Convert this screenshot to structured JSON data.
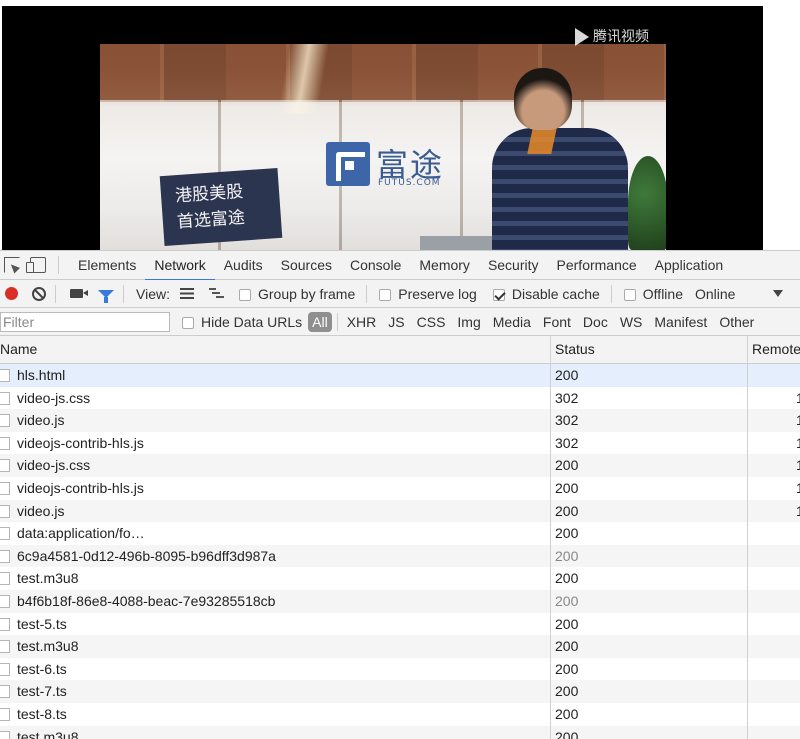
{
  "video": {
    "logo_text": "富途",
    "logo_sub": "FUTUS.COM",
    "poster_lines": [
      "港股美股",
      "首选富途"
    ],
    "watermark": "腾讯视频"
  },
  "devtools": {
    "tabs": [
      {
        "label": "Elements",
        "active": false
      },
      {
        "label": "Network",
        "active": true
      },
      {
        "label": "Audits",
        "active": false
      },
      {
        "label": "Sources",
        "active": false
      },
      {
        "label": "Console",
        "active": false
      },
      {
        "label": "Memory",
        "active": false
      },
      {
        "label": "Security",
        "active": false
      },
      {
        "label": "Performance",
        "active": false
      },
      {
        "label": "Application",
        "active": false
      }
    ],
    "toolbar": {
      "view_label": "View:",
      "group_by_frame": {
        "label": "Group by frame",
        "checked": false
      },
      "preserve_log": {
        "label": "Preserve log",
        "checked": false
      },
      "disable_cache": {
        "label": "Disable cache",
        "checked": true
      },
      "offline": {
        "label": "Offline",
        "checked": false
      },
      "throttle_value": "Online"
    },
    "filterbar": {
      "placeholder": "Filter",
      "hide_data_urls": {
        "label": "Hide Data URLs",
        "checked": false
      },
      "types": [
        "All",
        "XHR",
        "JS",
        "CSS",
        "Img",
        "Media",
        "Font",
        "Doc",
        "WS",
        "Manifest",
        "Other"
      ],
      "active_type": "All"
    },
    "table": {
      "columns": {
        "name": "Name",
        "status": "Status",
        "remote": "Remote"
      },
      "rows": [
        {
          "name": "hls.html",
          "status": "200",
          "remote": "",
          "selected": true,
          "muted": false
        },
        {
          "name": "video-js.css",
          "status": "302",
          "remote": "1",
          "selected": false,
          "muted": false
        },
        {
          "name": "video.js",
          "status": "302",
          "remote": "1",
          "selected": false,
          "muted": false
        },
        {
          "name": "videojs-contrib-hls.js",
          "status": "302",
          "remote": "1",
          "selected": false,
          "muted": false
        },
        {
          "name": "video-js.css",
          "status": "200",
          "remote": "1",
          "selected": false,
          "muted": false
        },
        {
          "name": "videojs-contrib-hls.js",
          "status": "200",
          "remote": "1",
          "selected": false,
          "muted": false
        },
        {
          "name": "video.js",
          "status": "200",
          "remote": "1",
          "selected": false,
          "muted": false
        },
        {
          "name": "data:application/fo…",
          "status": "200",
          "remote": "",
          "selected": false,
          "muted": false
        },
        {
          "name": "6c9a4581-0d12-496b-8095-b96dff3d987a",
          "status": "200",
          "remote": "",
          "selected": false,
          "muted": true
        },
        {
          "name": "test.m3u8",
          "status": "200",
          "remote": "",
          "selected": false,
          "muted": false
        },
        {
          "name": "b4f6b18f-86e8-4088-beac-7e93285518cb",
          "status": "200",
          "remote": "",
          "selected": false,
          "muted": true
        },
        {
          "name": "test-5.ts",
          "status": "200",
          "remote": "",
          "selected": false,
          "muted": false
        },
        {
          "name": "test.m3u8",
          "status": "200",
          "remote": "",
          "selected": false,
          "muted": false
        },
        {
          "name": "test-6.ts",
          "status": "200",
          "remote": "",
          "selected": false,
          "muted": false
        },
        {
          "name": "test-7.ts",
          "status": "200",
          "remote": "",
          "selected": false,
          "muted": false
        },
        {
          "name": "test-8.ts",
          "status": "200",
          "remote": "",
          "selected": false,
          "muted": false
        },
        {
          "name": "test.m3u8",
          "status": "200",
          "remote": "",
          "selected": false,
          "muted": false
        }
      ]
    }
  },
  "colors": {
    "accent": "#3879d9",
    "record": "#d93025",
    "selected_row": "#e4eefc"
  }
}
